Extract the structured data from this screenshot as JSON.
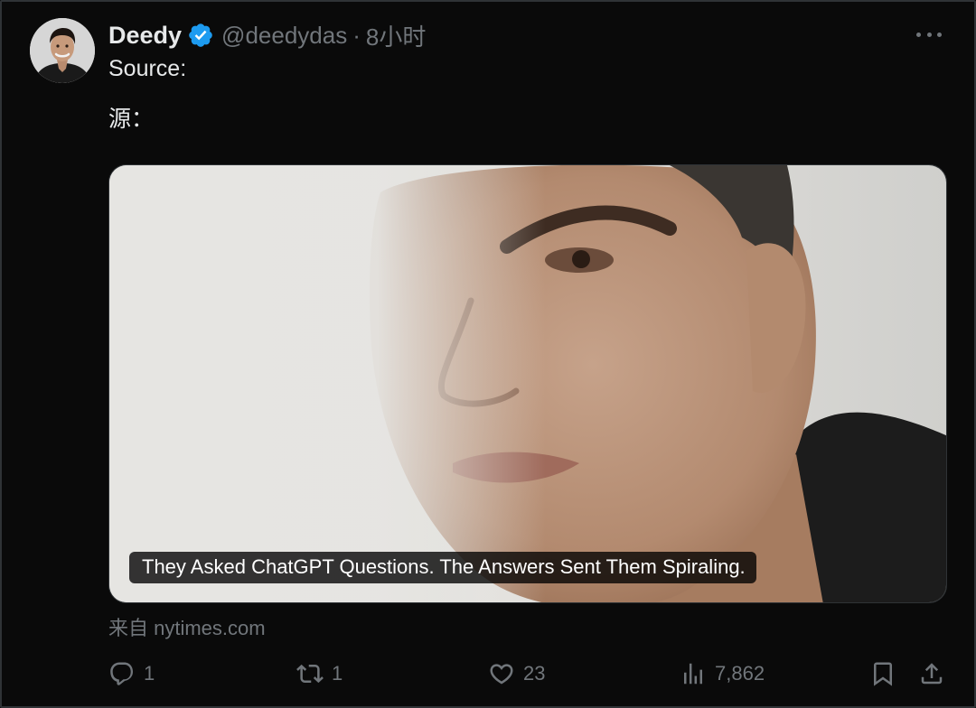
{
  "tweet": {
    "author": {
      "name": "Deedy",
      "handle": "@deedydas",
      "time": "8小时",
      "separator": "·",
      "verified": true,
      "avatar_icon": "avatar-photo"
    },
    "text_lines": [
      "Source:",
      "源："
    ],
    "card": {
      "headline": "They Asked ChatGPT Questions. The Answers Sent Them Spiraling.",
      "source": "来自 nytimes.com"
    },
    "actions": {
      "replies": "1",
      "retweets": "1",
      "likes": "23",
      "views": "7,862"
    }
  },
  "colors": {
    "background": "#0a0a0a",
    "text": "#e7e9ea",
    "secondary": "#71767b",
    "verified": "#1d9bf0",
    "border": "#2f3336"
  },
  "icons": [
    "verified-badge-icon",
    "more-icon",
    "reply-icon",
    "retweet-icon",
    "like-icon",
    "views-icon",
    "bookmark-icon",
    "share-icon"
  ]
}
